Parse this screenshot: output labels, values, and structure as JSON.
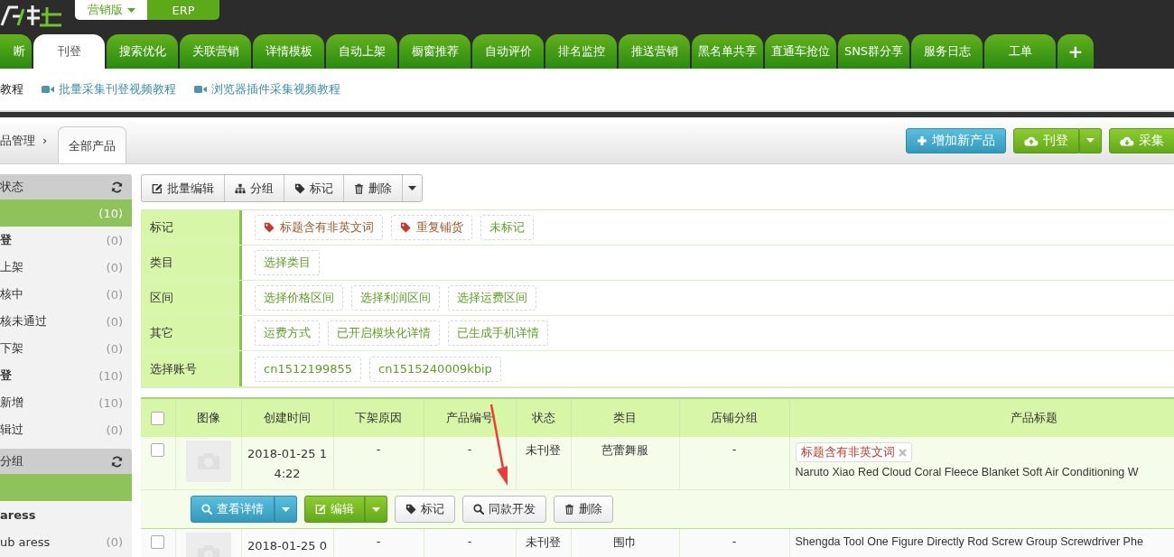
{
  "edition_switch": [
    {
      "label": "营销版",
      "selected": true,
      "dropdown": true
    },
    {
      "label": "ERP",
      "selected": false,
      "dropdown": false
    }
  ],
  "tabs": [
    {
      "label": "断",
      "selected": false
    },
    {
      "label": "刊登",
      "selected": true
    },
    {
      "label": "搜索优化",
      "selected": false
    },
    {
      "label": "关联营销",
      "selected": false
    },
    {
      "label": "详情模板",
      "selected": false
    },
    {
      "label": "自动上架",
      "selected": false
    },
    {
      "label": "橱窗推荐",
      "selected": false
    },
    {
      "label": "自动评价",
      "selected": false
    },
    {
      "label": "排名监控",
      "selected": false
    },
    {
      "label": "推送营销",
      "selected": false
    },
    {
      "label": "黑名单共享",
      "selected": false
    },
    {
      "label": "直通车抢位",
      "selected": false
    },
    {
      "label": "SNS群分享",
      "selected": false
    },
    {
      "label": "服务日志",
      "selected": false
    },
    {
      "label": "工单",
      "selected": false
    },
    {
      "label": "+",
      "selected": false
    }
  ],
  "tutorial_links": [
    {
      "text": "教程",
      "kind": "plain"
    },
    {
      "text": "批量采集刊登视频教程",
      "kind": "video"
    },
    {
      "text": "浏览器插件采集视频教程",
      "kind": "video"
    }
  ],
  "breadcrumb": {
    "parent": "品管理",
    "separator": "›",
    "current": "全部产品"
  },
  "header_buttons": [
    {
      "label": "增加新产品",
      "kind": "add",
      "split": false
    },
    {
      "label": "刊登",
      "kind": "publish",
      "split": true
    },
    {
      "label": "采集",
      "kind": "collect",
      "split": false
    }
  ],
  "sidebar": {
    "sections": [
      {
        "title": "状态",
        "items": [
          {
            "count": "(10)",
            "selected": true,
            "kind": "normal"
          },
          {
            "label": "登",
            "count": "(0)",
            "selected": false,
            "kind": "bold"
          },
          {
            "label": "上架",
            "count": "(0)",
            "selected": false,
            "kind": "normal"
          },
          {
            "label": "核中",
            "count": "(0)",
            "selected": false,
            "kind": "normal"
          },
          {
            "label": "核未通过",
            "count": "(0)",
            "selected": false,
            "kind": "normal"
          },
          {
            "label": "下架",
            "count": "(0)",
            "selected": false,
            "kind": "normal"
          },
          {
            "label": "登",
            "count": "(10)",
            "selected": false,
            "kind": "bold"
          },
          {
            "label": "新增",
            "count": "(10)",
            "selected": false,
            "kind": "normal"
          },
          {
            "label": "辑过",
            "count": "(0)",
            "selected": false,
            "kind": "normal"
          }
        ]
      },
      {
        "title": "分组",
        "items": [
          {
            "selected": true,
            "kind": "normal"
          },
          {
            "label": "aress",
            "selected": false,
            "kind": "bold"
          },
          {
            "label": "ub aress",
            "count": "(0)",
            "selected": false,
            "kind": "normal"
          }
        ]
      }
    ]
  },
  "toolbar": {
    "buttons": [
      {
        "label": "批量编辑",
        "kind": "edit"
      },
      {
        "label": "分组",
        "kind": "group"
      },
      {
        "label": "标记",
        "kind": "tag"
      },
      {
        "label": "删除",
        "kind": "delete"
      }
    ],
    "dropdown": true
  },
  "filters": [
    {
      "label": "标记",
      "chips": [
        {
          "text": "标题含有非英文词",
          "kind": "tag"
        },
        {
          "text": "重复铺货",
          "kind": "tag"
        },
        {
          "text": "未标记",
          "kind": "plain"
        }
      ]
    },
    {
      "label": "类目",
      "chips": [
        {
          "text": "选择类目",
          "kind": "plain"
        }
      ]
    },
    {
      "label": "区间",
      "chips": [
        {
          "text": "选择价格区间",
          "kind": "plain"
        },
        {
          "text": "选择利润区间",
          "kind": "plain"
        },
        {
          "text": "选择运费区间",
          "kind": "plain"
        }
      ]
    },
    {
      "label": "其它",
      "chips": [
        {
          "text": "运费方式",
          "kind": "plain"
        },
        {
          "text": "已开启模块化详情",
          "kind": "plain"
        },
        {
          "text": "已生成手机详情",
          "kind": "plain"
        }
      ]
    },
    {
      "label": "选择账号",
      "chips": [
        {
          "text": "cn1512199855",
          "kind": "plain"
        },
        {
          "text": "cn1515240009kbip",
          "kind": "plain"
        }
      ]
    }
  ],
  "products": {
    "columns": [
      "图像",
      "创建时间",
      "下架原因",
      "产品编号",
      "状态",
      "类目",
      "店铺分组",
      "产品标题"
    ],
    "all_checked": false,
    "rows": [
      {
        "checked": false,
        "created": "2018-01-25 14:22",
        "delist_reason": "-",
        "product_code": "-",
        "status": "未刊登",
        "category": "芭蕾舞服",
        "shop_group": "-",
        "tags": [
          "标题含有非英文词"
        ],
        "title": "Naruto Xiao Red Cloud Coral Fleece Blanket Soft Air Conditioning W",
        "actions": [
          {
            "label": "查看详情",
            "kind": "view",
            "split": true
          },
          {
            "label": "编辑",
            "kind": "edit",
            "split": true
          },
          {
            "label": "标记",
            "kind": "tag",
            "split": false
          },
          {
            "label": "同款开发",
            "kind": "similar",
            "split": false
          },
          {
            "label": "删除",
            "kind": "delete",
            "split": false
          }
        ]
      },
      {
        "checked": false,
        "created": "2018-01-25 0",
        "delist_reason": "-",
        "product_code": "-",
        "status": "未刊登",
        "category": "围巾",
        "shop_group": "-",
        "tags": [],
        "title": "Shengda Tool One Figure Directly Rod Screw Group Screwdriver Phe"
      }
    ]
  }
}
